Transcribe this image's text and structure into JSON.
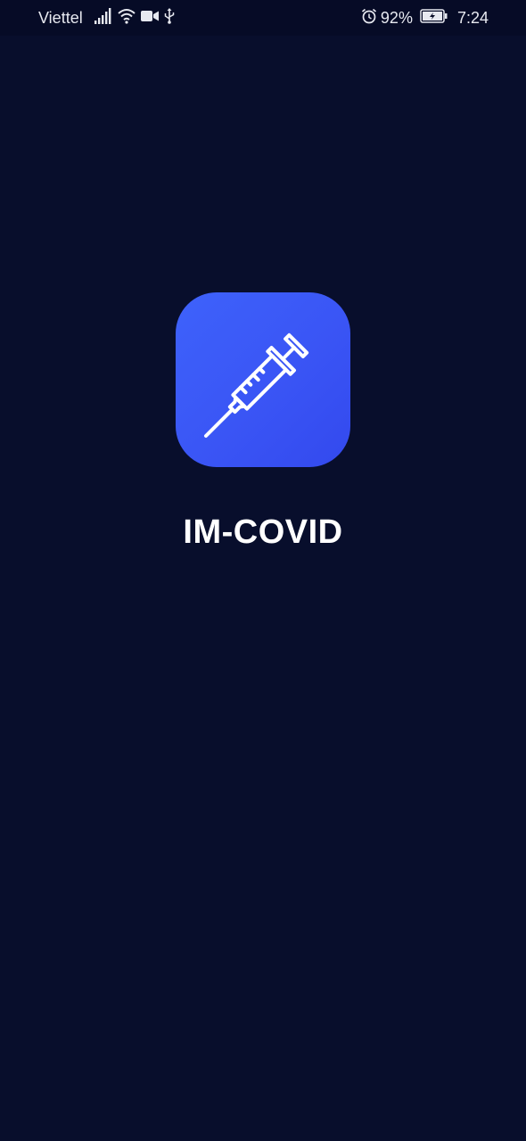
{
  "status_bar": {
    "carrier": "Viettel",
    "battery_percent": "92%",
    "time": "7:24",
    "icons": [
      "signal-icon",
      "wifi-icon",
      "video-call-icon",
      "usb-icon",
      "alarm-icon",
      "battery-charging-icon"
    ]
  },
  "splash": {
    "app_name": "IM-COVID",
    "logo_icon": "syringe-icon"
  },
  "colors": {
    "background": "#080e2c",
    "status_bar": "#060b26",
    "icon_gradient_start": "#3e62fb",
    "icon_gradient_end": "#3349ee",
    "title": "#ffffff"
  }
}
